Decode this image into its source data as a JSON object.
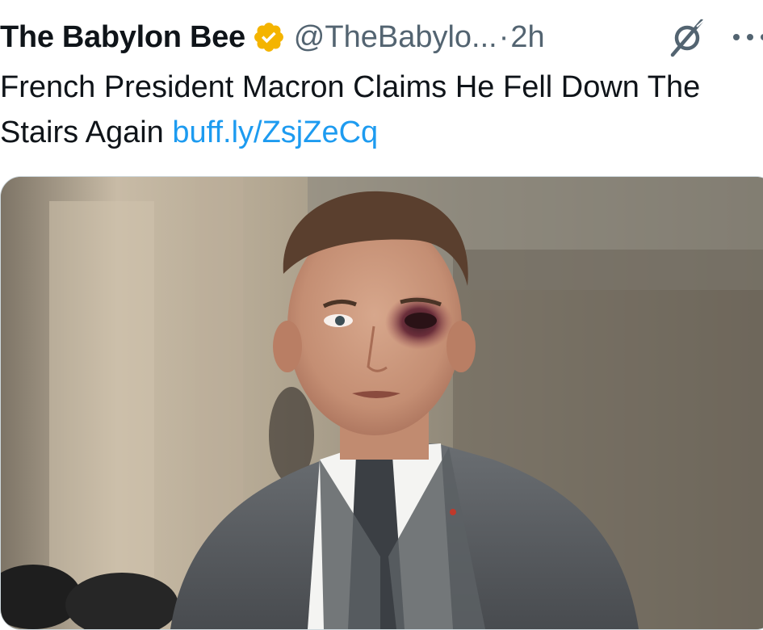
{
  "tweet": {
    "display_name": "The Babylon Bee",
    "handle": "@TheBabylo...",
    "separator": "·",
    "time": "2h",
    "text": "French President Macron Claims He Fell Down The Stairs Again ",
    "link": "buff.ly/ZsjZeCq",
    "verified_badge_color": "#f4b400",
    "link_color": "#1d9bf0",
    "secondary_text_color": "#536471"
  },
  "icons": {
    "verified": "verified-badge-icon",
    "grok": "grok-icon",
    "more": "more-options-icon"
  }
}
